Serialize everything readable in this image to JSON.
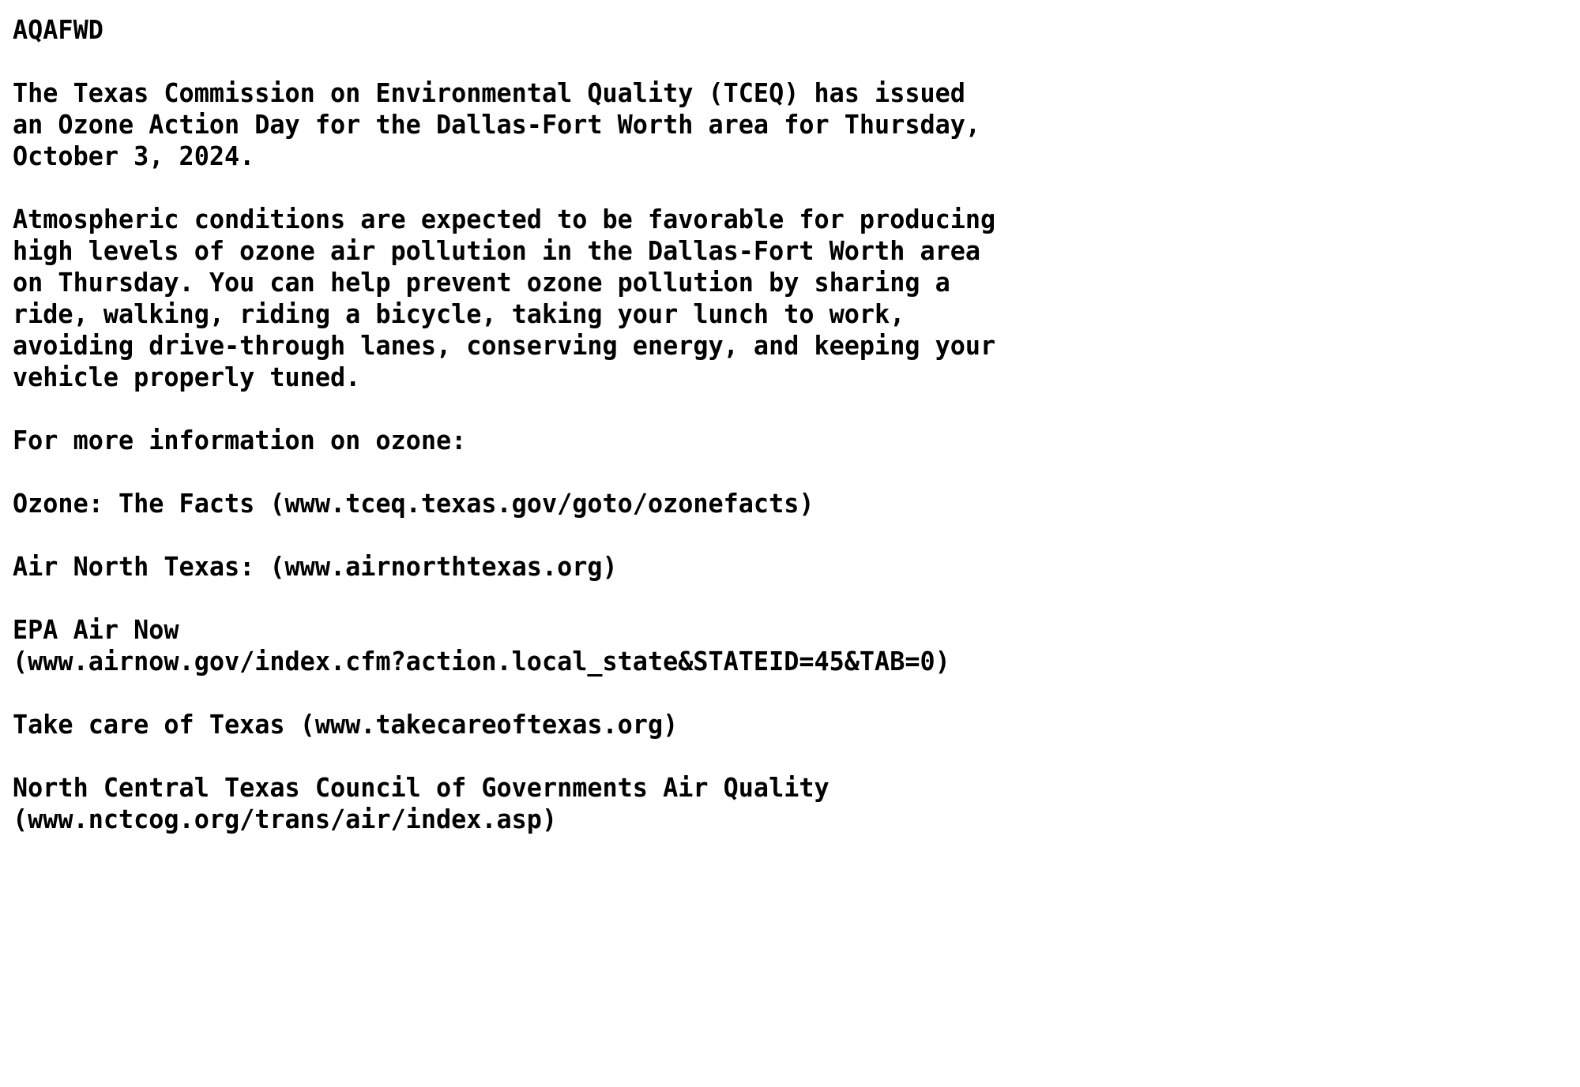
{
  "document": {
    "product_id": "AQAFWD",
    "background_color": "#ffffff",
    "text_color": "#000000",
    "blocks": [
      {
        "name": "product-identifier",
        "lines": [
          "AQAFWD"
        ]
      },
      {
        "name": "blank",
        "lines": [
          ""
        ]
      },
      {
        "name": "issuance-paragraph",
        "lines": [
          "The Texas Commission on Environmental Quality (TCEQ) has issued",
          "an Ozone Action Day for the Dallas-Fort Worth area for Thursday,",
          "October 3, 2024."
        ]
      },
      {
        "name": "blank",
        "lines": [
          ""
        ]
      },
      {
        "name": "conditions-paragraph",
        "lines": [
          "Atmospheric conditions are expected to be favorable for producing",
          "high levels of ozone air pollution in the Dallas-Fort Worth area",
          "on Thursday. You can help prevent ozone pollution by sharing a",
          "ride, walking, riding a bicycle, taking your lunch to work,",
          "avoiding drive-through lanes, conserving energy, and keeping your",
          "vehicle properly tuned."
        ]
      },
      {
        "name": "blank",
        "lines": [
          ""
        ]
      },
      {
        "name": "more-information-heading",
        "lines": [
          "For more information on ozone:"
        ]
      },
      {
        "name": "blank",
        "lines": [
          ""
        ]
      },
      {
        "name": "resource-ozone-facts",
        "lines": [
          "Ozone: The Facts (www.tceq.texas.gov/goto/ozonefacts)"
        ]
      },
      {
        "name": "blank",
        "lines": [
          ""
        ]
      },
      {
        "name": "resource-air-north-texas",
        "lines": [
          "Air North Texas: (www.airnorthtexas.org)"
        ]
      },
      {
        "name": "blank",
        "lines": [
          ""
        ]
      },
      {
        "name": "resource-epa-air-now",
        "lines": [
          "EPA Air Now",
          "(www.airnow.gov/index.cfm?action.local_state&STATEID=45&TAB=0)"
        ]
      },
      {
        "name": "blank",
        "lines": [
          ""
        ]
      },
      {
        "name": "resource-take-care-of-texas",
        "lines": [
          "Take care of Texas (www.takecareoftexas.org)"
        ]
      },
      {
        "name": "blank",
        "lines": [
          ""
        ]
      },
      {
        "name": "resource-nctcog",
        "lines": [
          "North Central Texas Council of Governments Air Quality",
          "(www.nctcog.org/trans/air/index.asp)"
        ]
      }
    ]
  }
}
